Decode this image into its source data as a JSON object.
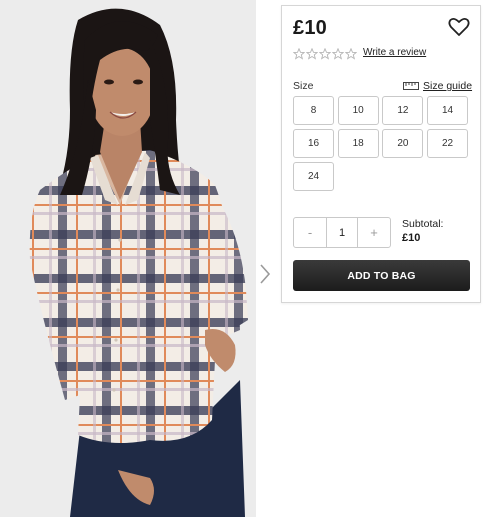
{
  "product": {
    "price": "£10",
    "rating_stars": 0,
    "review_link": "Write a review"
  },
  "size": {
    "label": "Size",
    "guide_label": "Size guide",
    "options": [
      "8",
      "10",
      "12",
      "14",
      "16",
      "18",
      "20",
      "22",
      "24"
    ]
  },
  "quantity": {
    "decrement": "-",
    "value": "1",
    "increment": "+"
  },
  "subtotal": {
    "label": "Subtotal:",
    "value": "£10"
  },
  "actions": {
    "add_to_bag": "ADD TO BAG"
  },
  "icons": {
    "wishlist": "heart-icon",
    "gallery_next": "chevron-right-icon",
    "size_guide": "ruler-icon",
    "rating": "star-icon"
  },
  "colors": {
    "button_bg": "#2a2a2a",
    "border": "#c9c9c9"
  }
}
